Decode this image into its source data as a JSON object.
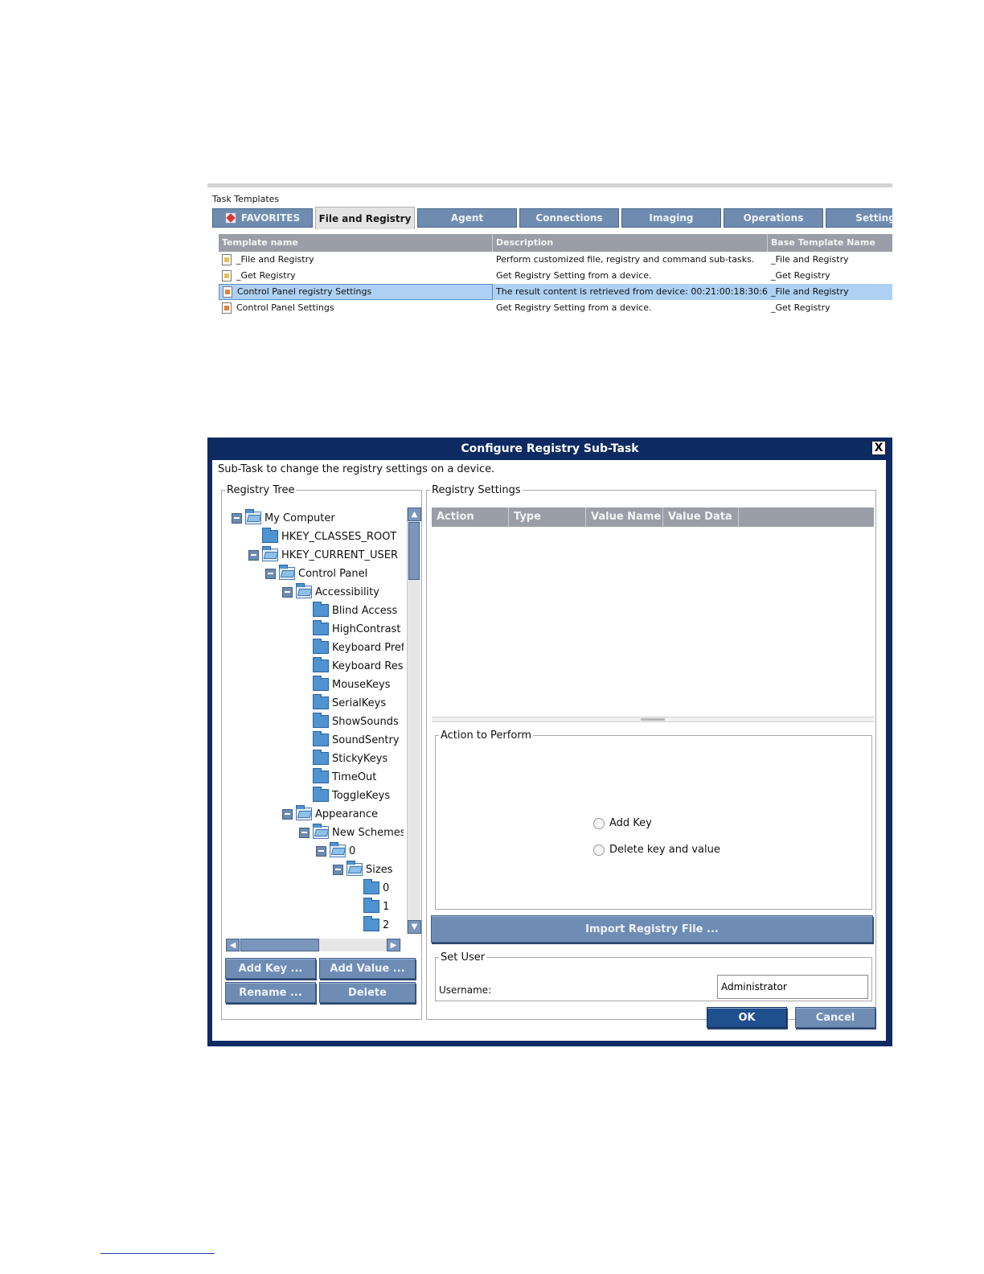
{
  "task_templates": {
    "title": "Task Templates",
    "tabs": [
      {
        "label": "FAVORITES"
      },
      {
        "label": "File and Registry"
      },
      {
        "label": "Agent"
      },
      {
        "label": "Connections"
      },
      {
        "label": "Imaging"
      },
      {
        "label": "Operations"
      },
      {
        "label": "Setting"
      }
    ],
    "columns": [
      "Template name",
      "Description",
      "Base Template Name"
    ],
    "rows": [
      {
        "name": "_File and Registry",
        "description": "Perform customized file, registry and command sub-tasks.",
        "base": "_File and Registry"
      },
      {
        "name": "_Get Registry",
        "description": "Get Registry Setting from a device.",
        "base": "_Get Registry"
      },
      {
        "name": "Control Panel registry Settings",
        "description": "The result content is retrieved from device: 00:21:00:18:30:6...",
        "base": "_File and Registry"
      },
      {
        "name": "Control Panel Settings",
        "description": "Get Registry Setting from a device.",
        "base": "_Get Registry"
      }
    ]
  },
  "dialog": {
    "title": "Configure Registry Sub-Task",
    "close_label": "X",
    "subtitle": "Sub-Task to change the registry settings on a device.",
    "registry_tree": {
      "legend": "Registry Tree",
      "nodes": [
        {
          "label": "My Computer"
        },
        {
          "label": "HKEY_CLASSES_ROOT"
        },
        {
          "label": "HKEY_CURRENT_USER"
        },
        {
          "label": "Control Panel"
        },
        {
          "label": "Accessibility"
        },
        {
          "label": "Blind Access"
        },
        {
          "label": "HighContrast"
        },
        {
          "label": "Keyboard Pref"
        },
        {
          "label": "Keyboard Res"
        },
        {
          "label": "MouseKeys"
        },
        {
          "label": "SerialKeys"
        },
        {
          "label": "ShowSounds"
        },
        {
          "label": "SoundSentry"
        },
        {
          "label": "StickyKeys"
        },
        {
          "label": "TimeOut"
        },
        {
          "label": "ToggleKeys"
        },
        {
          "label": "Appearance"
        },
        {
          "label": "New Schemes"
        },
        {
          "label": "0"
        },
        {
          "label": "Sizes"
        },
        {
          "label": "0"
        },
        {
          "label": "1"
        },
        {
          "label": "2"
        }
      ],
      "buttons": {
        "add_key": "Add Key ...",
        "add_value": "Add Value ...",
        "rename": "Rename ...",
        "delete": "Delete"
      }
    },
    "registry_settings": {
      "legend": "Registry Settings",
      "columns": [
        "Action",
        "Type",
        "Value Name",
        "Value Data"
      ]
    },
    "action_to_perform": {
      "legend": "Action to Perform",
      "options": [
        "Add Key",
        "Delete key and value"
      ]
    },
    "import_button": "Import Registry File ...",
    "set_user": {
      "legend": "Set User",
      "username_label": "Username:",
      "username_value": "Administrator"
    },
    "ok_label": "OK",
    "cancel_label": "Cancel"
  }
}
